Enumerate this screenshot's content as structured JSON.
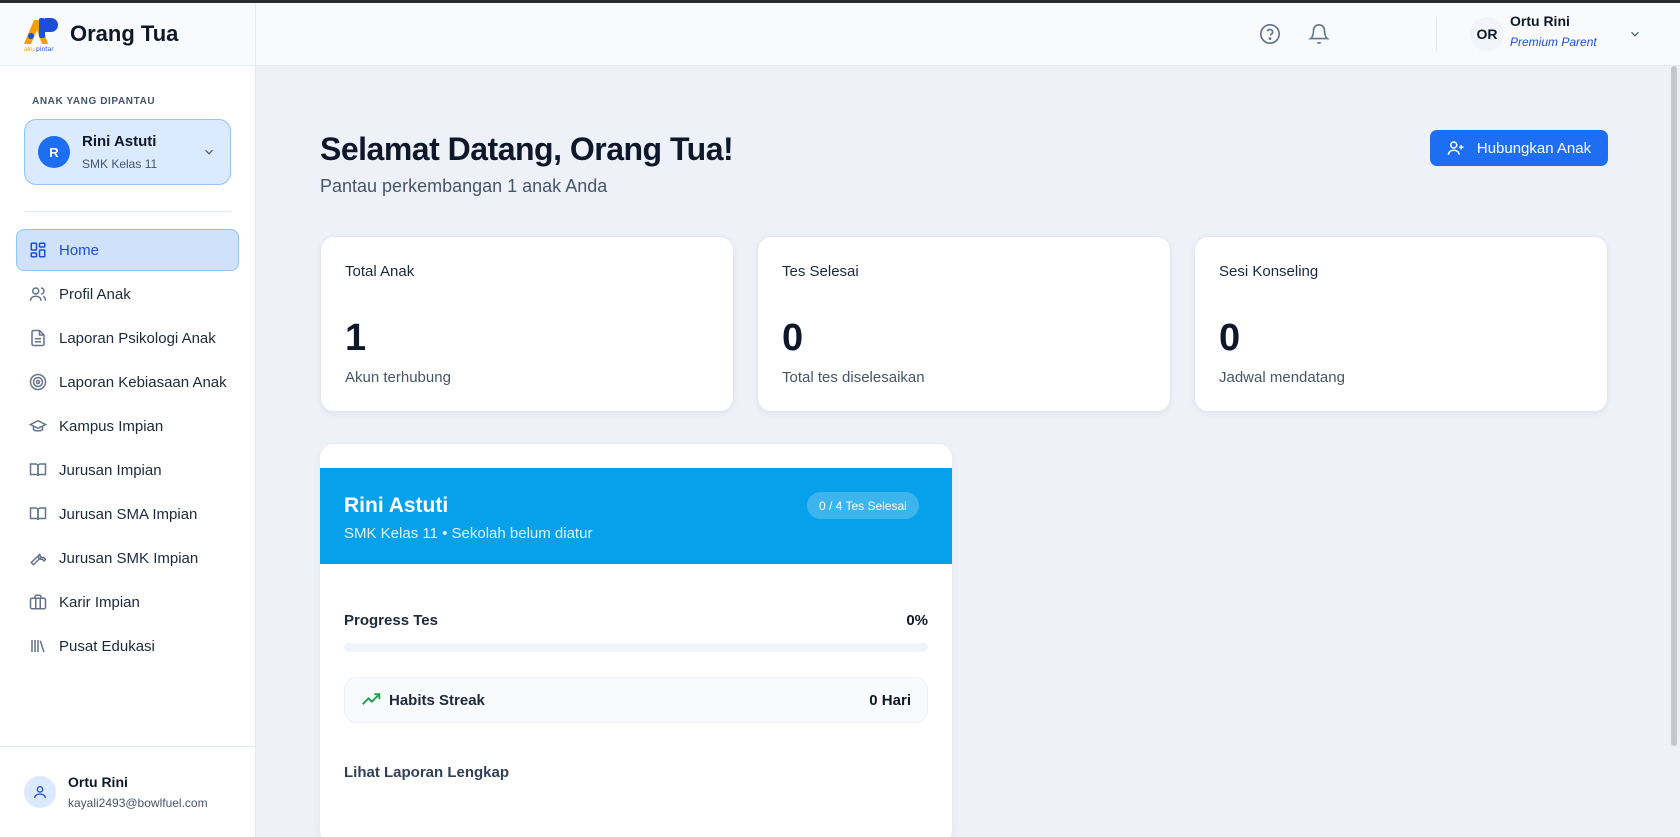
{
  "brand": {
    "title": "Orang Tua",
    "logo_text": "aku pintar"
  },
  "sidebar": {
    "section_label": "ANAK YANG DIPANTAU",
    "child": {
      "initial": "R",
      "name": "Rini Astuti",
      "class": "SMK Kelas 11"
    },
    "items": [
      {
        "label": "Home",
        "icon": "dashboard-grid-icon",
        "active": true
      },
      {
        "label": "Profil Anak",
        "icon": "users-icon"
      },
      {
        "label": "Laporan Psikologi Anak",
        "icon": "document-icon"
      },
      {
        "label": "Laporan Kebiasaan Anak",
        "icon": "target-icon"
      },
      {
        "label": "Kampus Impian",
        "icon": "graduation-cap-icon"
      },
      {
        "label": "Jurusan Impian",
        "icon": "book-open-icon"
      },
      {
        "label": "Jurusan SMA Impian",
        "icon": "book-open-icon"
      },
      {
        "label": "Jurusan SMK Impian",
        "icon": "wrench-icon"
      },
      {
        "label": "Karir Impian",
        "icon": "briefcase-icon"
      },
      {
        "label": "Pusat Edukasi",
        "icon": "library-icon"
      }
    ],
    "user": {
      "name": "Ortu Rini",
      "email": "kayali2493@bowlfuel.com"
    }
  },
  "topbar": {
    "avatar_initials": "OR",
    "user_name": "Ortu Rini",
    "user_role": "Premium Parent"
  },
  "main": {
    "title": "Selamat Datang, Orang Tua!",
    "subtitle": "Pantau perkembangan 1 anak Anda",
    "connect_button": "Hubungkan Anak",
    "stats": [
      {
        "label": "Total Anak",
        "value": "1",
        "caption": "Akun terhubung"
      },
      {
        "label": "Tes Selesai",
        "value": "0",
        "caption": "Total tes diselesaikan"
      },
      {
        "label": "Sesi Konseling",
        "value": "0",
        "caption": "Jadwal mendatang"
      }
    ],
    "child_card": {
      "name": "Rini Astuti",
      "subtitle": "SMK Kelas 11 • Sekolah belum diatur",
      "tests_badge": "0 / 4 Tes Selesai",
      "progress_label": "Progress Tes",
      "progress_value": "0%",
      "progress_fraction": 0,
      "streak_label": "Habits Streak",
      "streak_value": "0 Hari",
      "report_link": "Lihat Laporan Lengkap"
    }
  },
  "colors": {
    "primary": "#1d6ef3",
    "banner": "#06a0eb",
    "streak_green": "#16a34a"
  }
}
